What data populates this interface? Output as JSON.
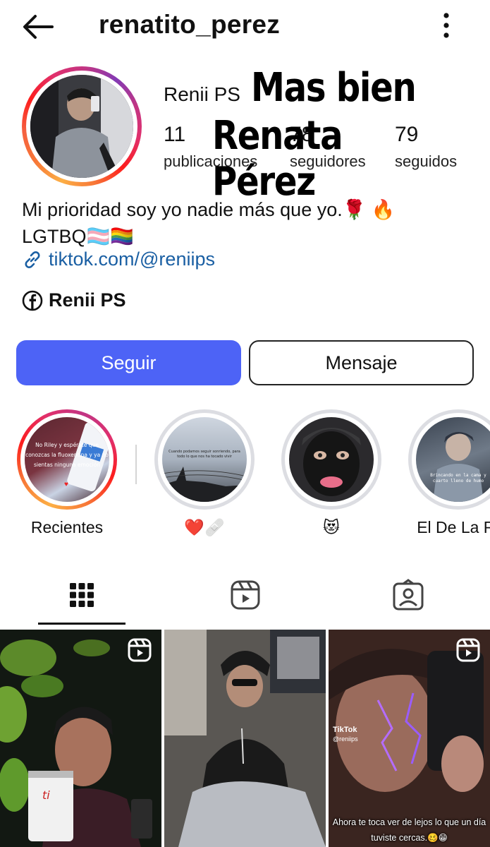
{
  "header": {
    "username": "renatito_perez",
    "back_icon": "arrow-left-icon",
    "more_icon": "more-vertical-icon"
  },
  "profile": {
    "display_name": "Renii PS",
    "stats": [
      {
        "value": "11",
        "label": "publicaciones"
      },
      {
        "value": "78",
        "label": "seguidores"
      },
      {
        "value": "79",
        "label": "seguidos"
      }
    ],
    "overlay_text": [
      "Mas bien",
      "Renata Pérez"
    ],
    "bio_line1": "Mi prioridad soy yo nadie más que yo.🌹 🔥",
    "bio_line2": "LGTBQ🏳️‍⚧️🏳️‍🌈",
    "link": "tiktok.com/@reniips",
    "facebook_name": "Renii PS"
  },
  "actions": {
    "follow_label": "Seguir",
    "message_label": "Mensaje",
    "follow_color": "#4d63f6"
  },
  "highlights": [
    {
      "label": "Recientes",
      "text": "No Riley y espérate que conozcas la fluoxentina y ya no sientas ninguna emoción"
    },
    {
      "label": "❤️🩹",
      "text": "Cuando podamos seguir sonriendo, para todo lo que nos ha tocado vivir"
    },
    {
      "label": "😻",
      "text": ""
    },
    {
      "label": "El De La R.",
      "text": "Brincando en la cama y cuarto lleno de humo"
    }
  ],
  "tabs": [
    {
      "name": "grid",
      "icon": "grid-icon"
    },
    {
      "name": "reels",
      "icon": "reels-icon"
    },
    {
      "name": "tagged",
      "icon": "tagged-icon"
    }
  ],
  "grid": {
    "tiktok_label": "TikTok",
    "tiktok_handle": "@reniips",
    "caption": "Ahora te toca ver de lejos lo que un día tuviste cercas.🥴😁"
  }
}
